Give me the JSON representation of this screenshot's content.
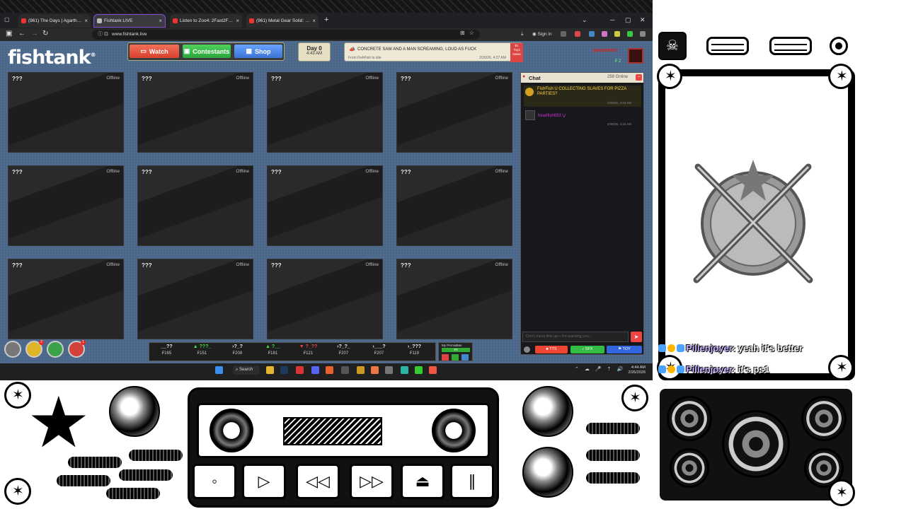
{
  "browser": {
    "tabs": [
      {
        "label": "(961) The Days | Agartha Remix",
        "favicon": "youtube-icon"
      },
      {
        "label": "Fishtank LIVE",
        "favicon": "fishtank-icon",
        "active": true
      },
      {
        "label": "Listen to Zoo4: 2Fast2Furious (Rem",
        "favicon": "youtube-icon"
      },
      {
        "label": "(961) Metal Gear Solid: Cyborg",
        "favicon": "youtube-icon"
      }
    ],
    "new_tab": "+",
    "url": "www.fishtank.live",
    "signin": "Sign in",
    "window_controls": [
      "─",
      "▢",
      "✕"
    ]
  },
  "site": {
    "logo": "fishtank",
    "logo_mark": "®",
    "nav": {
      "watch": "Watch",
      "contestants": "Contestants",
      "shop": "Shop"
    },
    "day": {
      "label": "Day 0",
      "time": "4:43 AM"
    },
    "announcement": {
      "text": "CONCRETE SAW AND A MAN SCREAMING, LOUD AS FUCK",
      "from": "From FishFish to site",
      "time": "2/26/26, 4:37 AM",
      "tags": [
        "$1",
        "Toys",
        "News"
      ]
    },
    "user": {
      "name": "poopeater",
      "coins": "₣ 2"
    },
    "cameras": [
      {
        "name": "???",
        "status": "Offline"
      },
      {
        "name": "???",
        "status": "Offline"
      },
      {
        "name": "???",
        "status": "Offline"
      },
      {
        "name": "???",
        "status": "Offline"
      },
      {
        "name": "???",
        "status": "Offline"
      },
      {
        "name": "???",
        "status": "Offline"
      },
      {
        "name": "???",
        "status": "Offline"
      },
      {
        "name": "???",
        "status": "Offline"
      },
      {
        "name": "???",
        "status": "Offline"
      },
      {
        "name": "???",
        "status": "Offline"
      },
      {
        "name": "???",
        "status": "Offline"
      },
      {
        "name": "???",
        "status": "Offline"
      }
    ],
    "chat": {
      "title": "Chat",
      "online": "259 Online",
      "messages": [
        {
          "text": "FishFish U COLLECTING SLAVES FOR PIZZA PARTIES?",
          "time": "2/26/26, 4:44 AM"
        },
        {
          "user": "headfish693 ⋁",
          "time": "2/26/26, 4:44 AM"
        }
      ],
      "input_placeholder": "Don't mess this up—I'm warning you...",
      "send": "➤",
      "buttons": {
        "tts": "TTS",
        "sfx": "SFX",
        "toy": "TOY"
      }
    },
    "bottom_badges": [
      "2",
      "1"
    ],
    "stats": [
      {
        "top": "__??",
        "bottom": "₣165",
        "dir": ""
      },
      {
        "top": "▲ ???_",
        "bottom": "₣151",
        "dir": "up"
      },
      {
        "top": "›?_?",
        "bottom": "₣208",
        "dir": ""
      },
      {
        "top": "▲ ?__",
        "bottom": "₣181",
        "dir": "up"
      },
      {
        "top": "▼ ?_??",
        "bottom": "₣121",
        "dir": "down"
      },
      {
        "top": "›?_?_",
        "bottom": "₣207",
        "dir": ""
      },
      {
        "top": "›___?",
        "bottom": "₣207",
        "dir": ""
      },
      {
        "top": "›_???",
        "bottom": "₣119",
        "dir": ""
      }
    ],
    "permaban": {
      "label": "My PermaBan",
      "value": "₣0"
    }
  },
  "taskbar": {
    "search": "Search",
    "time": "4:44 AM",
    "date": "2/26/2026"
  },
  "overlay": {
    "chat_lines": [
      {
        "user": "Pillenjoyer",
        "text": " yeah it's better"
      },
      {
        "user": "Pillenjoyer",
        "text": " it's ps1"
      }
    ]
  },
  "colors": {
    "site_bg": "#4b6789",
    "watch": "#e4553f",
    "contestants": "#35b845",
    "shop": "#4a86e8",
    "chat_highlight": "#ffd23f"
  }
}
